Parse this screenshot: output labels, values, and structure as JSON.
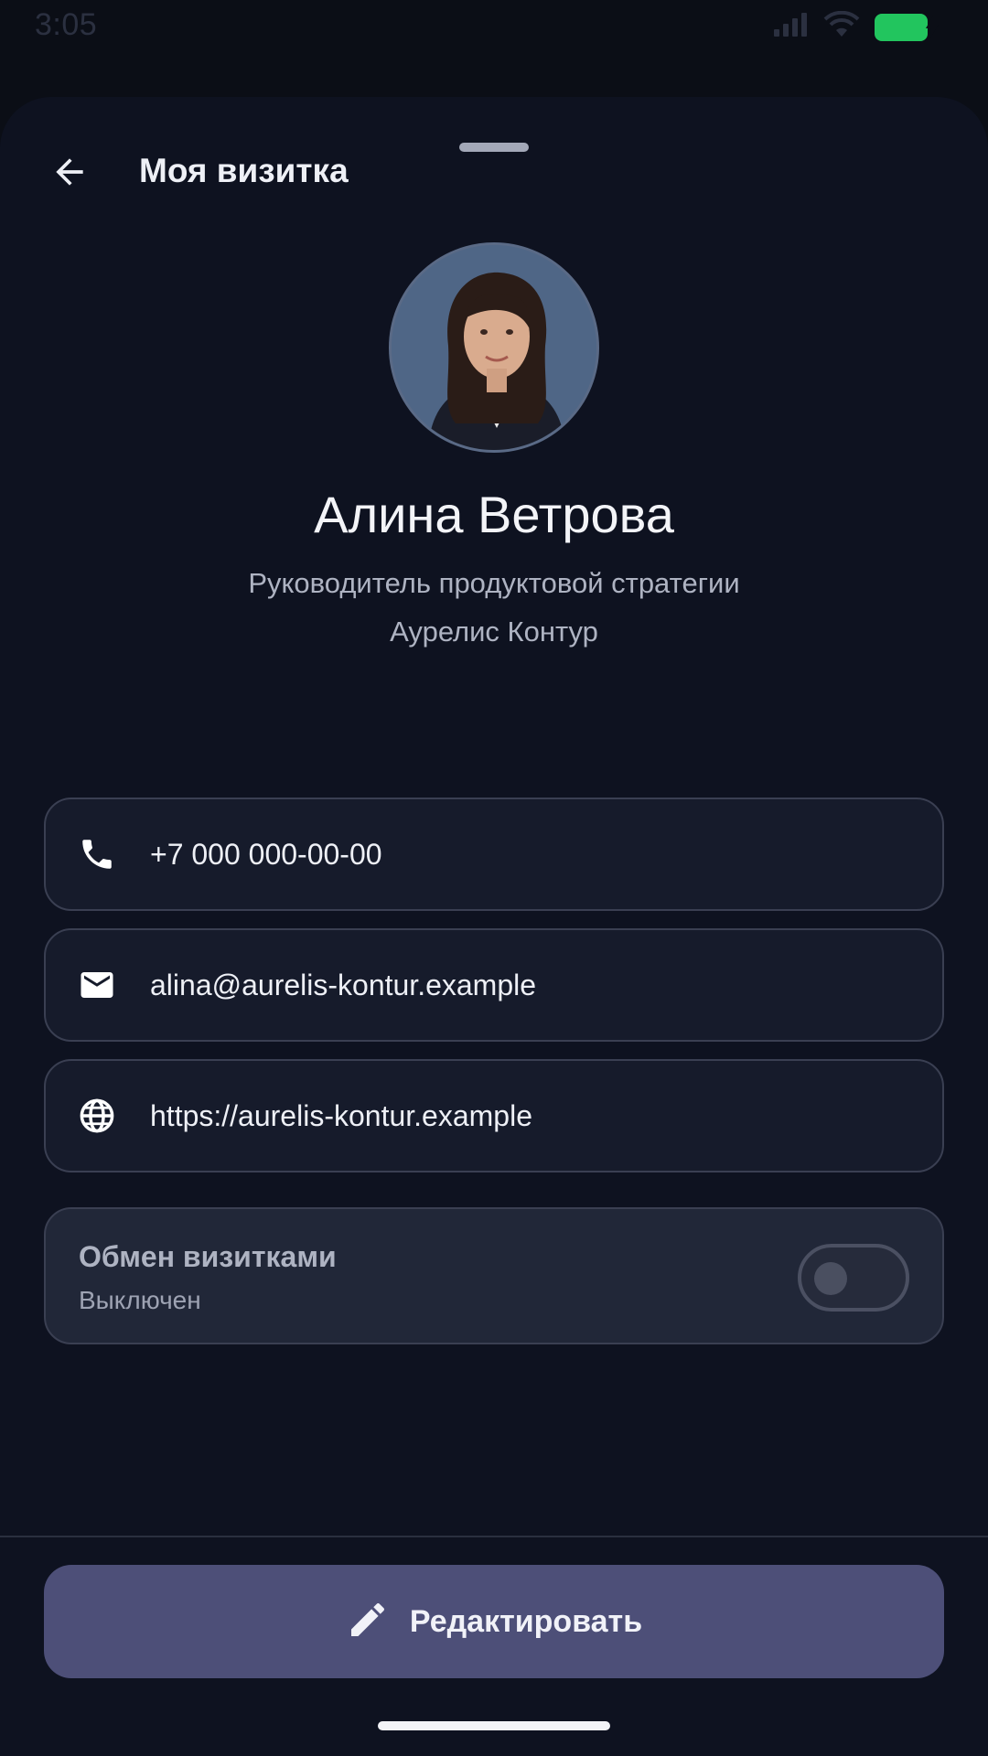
{
  "status_bar": {
    "time": "3:05",
    "icons": [
      "signal-icon",
      "wifi-icon",
      "battery-charging-icon"
    ],
    "battery_color": "#22c55e"
  },
  "app_bar": {
    "back_icon": "arrow-back-icon",
    "title": "Моя визитка"
  },
  "profile": {
    "name": "Алина Ветрова",
    "role": "Руководитель продуктовой стратегии",
    "company": "Аурелис Контур"
  },
  "contacts": {
    "phone": {
      "icon": "phone-icon",
      "value": "+7 000 000-00-00"
    },
    "email": {
      "icon": "mail-icon",
      "value": "alina@aurelis-kontur.example"
    },
    "website": {
      "icon": "globe-icon",
      "value": "https://aurelis-kontur.example"
    }
  },
  "exchange": {
    "title": "Обмен визитками",
    "status": "Выключен",
    "enabled": false
  },
  "actions": {
    "edit_icon": "pencil-icon",
    "edit_label": "Редактировать",
    "edit_color": "#4d4f78"
  },
  "theme": {
    "background": "#0b0e16",
    "sheet": "#0e1220",
    "card": "#161b2b",
    "card_border": "#3a3f52"
  }
}
